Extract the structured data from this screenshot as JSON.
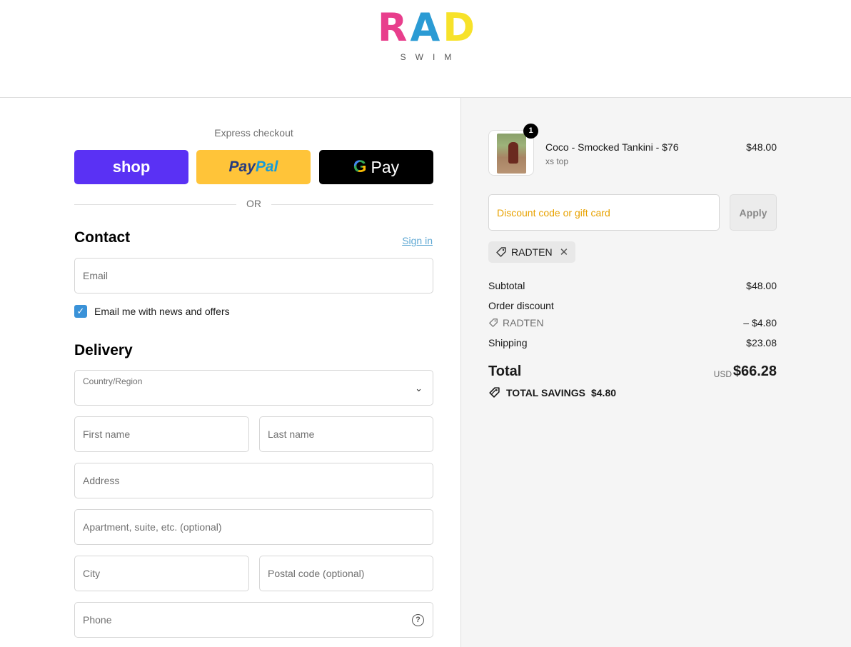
{
  "brand": {
    "logo_letters": [
      "R",
      "A",
      "D"
    ],
    "logo_sub": "SWIM"
  },
  "express": {
    "title": "Express checkout",
    "shop_label": "shop",
    "paypal_part1": "Pay",
    "paypal_part2": "Pal",
    "gpay_g": "G",
    "gpay_label": "Pay",
    "or_label": "OR"
  },
  "contact": {
    "title": "Contact",
    "signin_label": "Sign in",
    "email_placeholder": "Email",
    "newsletter_label": "Email me with news and offers",
    "newsletter_checked": true
  },
  "delivery": {
    "title": "Delivery",
    "country_label": "Country/Region",
    "first_name_placeholder": "First name",
    "last_name_placeholder": "Last name",
    "address_placeholder": "Address",
    "apartment_placeholder": "Apartment, suite, etc. (optional)",
    "city_placeholder": "City",
    "postal_placeholder": "Postal code (optional)",
    "phone_placeholder": "Phone"
  },
  "cart": {
    "item": {
      "quantity": "1",
      "name": "Coco - Smocked Tankini - $76",
      "variant": "xs top",
      "price": "$48.00"
    },
    "discount_placeholder": "Discount code or gift card",
    "apply_label": "Apply",
    "applied_code": "RADTEN"
  },
  "summary": {
    "subtotal_label": "Subtotal",
    "subtotal_value": "$48.00",
    "order_discount_label": "Order discount",
    "discount_code": "RADTEN",
    "discount_value": "– $4.80",
    "shipping_label": "Shipping",
    "shipping_value": "$23.08",
    "total_label": "Total",
    "currency": "USD",
    "total_value": "$66.28",
    "savings_label": "TOTAL SAVINGS",
    "savings_value": "$4.80"
  },
  "colors": {
    "shop": "#5a31f4",
    "paypal": "#ffc439",
    "gpay": "#000000",
    "link": "#5fa8d3",
    "checkbox": "#3a92d8",
    "discount_placeholder": "#e8a200"
  }
}
